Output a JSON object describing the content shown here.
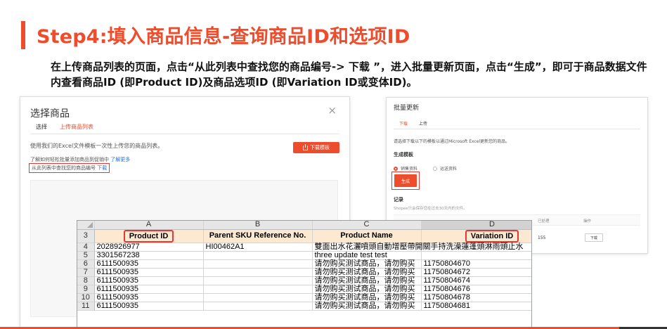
{
  "slide": {
    "title": "Step4:填入商品信息-查询商品ID和选项ID",
    "description": "在上传商品列表的页面，点击“从此列表中查找您的商品编号-> 下载 ”，进入批量更新页面，点击“生成”，即可于商品数据文件内查看商品ID (即Product ID)及商品选项ID (即Variation ID或变体ID)。"
  },
  "left_dialog": {
    "title": "选择商品",
    "close": "×",
    "tabs": [
      "选择",
      "上传商品列表"
    ],
    "description": "使用我们的Excel文件模板一次性上传您的商品列表。",
    "download_template_button": "下载模板",
    "link1_text": "了解如何轻松批量添加商品到促销中",
    "link1_more": "了解更多",
    "link2_text": "从此列表中查找您的商品编号",
    "link2_download": "下载"
  },
  "right_dialog": {
    "title": "批量更新",
    "tabs": [
      "下载",
      "上传"
    ],
    "description": "请选择下载以下的模板以通过Microsoft Excel更新您的商品。",
    "generate_template_label": "生成模板",
    "radio_options": [
      "销售资料",
      "运送资料"
    ],
    "generate_button": "生成",
    "records_label": "记录",
    "records_desc": "Shopee只会保存您在过去30天内的文件。",
    "col_processed": "已处理",
    "col_action": "操作",
    "processed_count": "155",
    "download_button": "下载"
  },
  "excel": {
    "columns": [
      "A",
      "B",
      "C",
      "D"
    ],
    "header_row_number": "3",
    "headers": [
      "Product ID",
      "Parent SKU Reference No.",
      "Product Name",
      "Variation ID"
    ],
    "rows": [
      {
        "n": "4",
        "a": "2028926977",
        "b": "HI00462A1",
        "c": "雙面出水花灑噴頭自動增壓帶開關手持洗澡蓮蓬頭淋雨頭止水",
        "d": ""
      },
      {
        "n": "5",
        "a": "3301567238",
        "b": "",
        "c": "three  update test  test",
        "d": ""
      },
      {
        "n": "6",
        "a": "6111500935",
        "b": "",
        "c": "请勿购买测试商品，请勿购买",
        "d": "11750804670"
      },
      {
        "n": "7",
        "a": "6111500935",
        "b": "",
        "c": "请勿购买测试商品，请勿购买",
        "d": "11750804672"
      },
      {
        "n": "8",
        "a": "6111500935",
        "b": "",
        "c": "请勿购买测试商品，请勿购买",
        "d": "11750804674"
      },
      {
        "n": "9",
        "a": "6111500935",
        "b": "",
        "c": "请勿购买测试商品，请勿购买",
        "d": "11750804676"
      },
      {
        "n": "10",
        "a": "6111500935",
        "b": "",
        "c": "请勿购买测试商品，请勿购买",
        "d": "11750804678"
      },
      {
        "n": "11",
        "a": "6111500935",
        "b": "",
        "c": "请勿购买测试商品，请勿购买",
        "d": "11750804681"
      }
    ]
  },
  "colors": {
    "accent": "#ee4d2d",
    "highlight_box": "#e53935",
    "link": "#2673dd"
  }
}
